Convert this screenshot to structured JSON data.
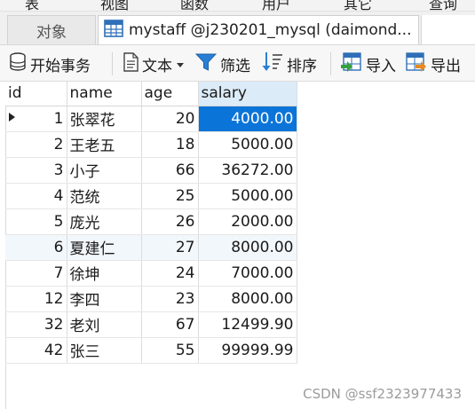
{
  "menubar": {
    "items": [
      "表",
      "视图",
      "函数",
      "用户",
      "其它",
      "查询"
    ]
  },
  "tabs": {
    "objects_label": "对象",
    "table_tab_label": "mystaff @j230201_mysql (daimond..."
  },
  "toolbar": {
    "begin_transaction": "开始事务",
    "text": "文本",
    "filter": "筛选",
    "sort": "排序",
    "import": "导入",
    "export": "导出"
  },
  "grid": {
    "columns": [
      "id",
      "name",
      "age",
      "salary"
    ],
    "rows": [
      {
        "id": "1",
        "name": "张翠花",
        "age": "20",
        "salary": "4000.00"
      },
      {
        "id": "2",
        "name": "王老五",
        "age": "18",
        "salary": "5000.00"
      },
      {
        "id": "3",
        "name": "小子",
        "age": "66",
        "salary": "36272.00"
      },
      {
        "id": "4",
        "name": "范统",
        "age": "25",
        "salary": "5000.00"
      },
      {
        "id": "5",
        "name": "庞光",
        "age": "26",
        "salary": "2000.00"
      },
      {
        "id": "6",
        "name": "夏建仁",
        "age": "27",
        "salary": "8000.00"
      },
      {
        "id": "7",
        "name": "徐坤",
        "age": "24",
        "salary": "7000.00"
      },
      {
        "id": "12",
        "name": "李四",
        "age": "23",
        "salary": "8000.00"
      },
      {
        "id": "32",
        "name": "老刘",
        "age": "67",
        "salary": "12499.90"
      },
      {
        "id": "42",
        "name": "张三",
        "age": "55",
        "salary": "99999.99"
      }
    ]
  },
  "watermark": "CSDN @ssf2323977433",
  "colors": {
    "selection": "#0a74d8",
    "header_selected": "#dcebf8"
  }
}
